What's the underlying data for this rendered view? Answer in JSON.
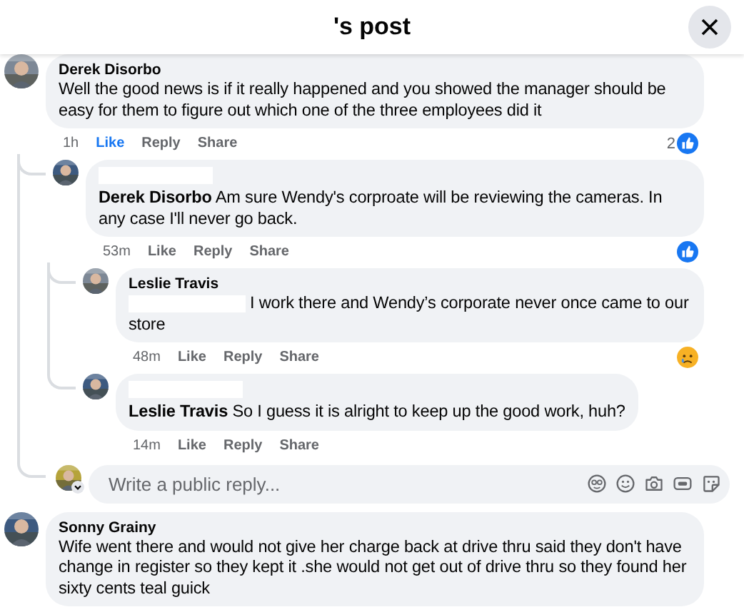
{
  "header": {
    "title": "'s post"
  },
  "comments": [
    {
      "author": "Derek Disorbo",
      "text": "Well the good news is if it really happened and you showed the manager should be easy for them to figure out which one of the three employees did it",
      "time": "1h",
      "actions": [
        "Like",
        "Reply",
        "Share"
      ],
      "liked": true,
      "reaction": {
        "kind": "like",
        "count": "2"
      },
      "children": [
        {
          "name_hidden": true,
          "mention": "Derek Disorbo",
          "text": "Am sure Wendy's corproate will be reviewing the cameras. In any case I'll never go back.",
          "time": "53m",
          "actions": [
            "Like",
            "Reply",
            "Share"
          ],
          "liked": false,
          "reaction": {
            "kind": "like"
          },
          "children": [
            {
              "author": "Leslie Travis",
              "name_hidden": true,
              "text": "I work there and Wendy’s corporate never once came to our store",
              "time": "48m",
              "actions": [
                "Like",
                "Reply",
                "Share"
              ],
              "liked": false,
              "reaction": {
                "kind": "sad"
              }
            },
            {
              "name_hidden": true,
              "mention": "Leslie Travis",
              "text": "So I guess it is alright to keep up the good work, huh?",
              "time": "14m",
              "actions": [
                "Like",
                "Reply",
                "Share"
              ],
              "liked": false
            }
          ]
        },
        {
          "kind": "reply_field",
          "placeholder": "Write a public reply..."
        }
      ]
    },
    {
      "author": "Sonny Grainy",
      "text": "Wife went there and would not give her charge back at drive thru said they don't have change in register so they kept it .she would not get out of drive thru so they found her sixty cents teal guick"
    }
  ]
}
